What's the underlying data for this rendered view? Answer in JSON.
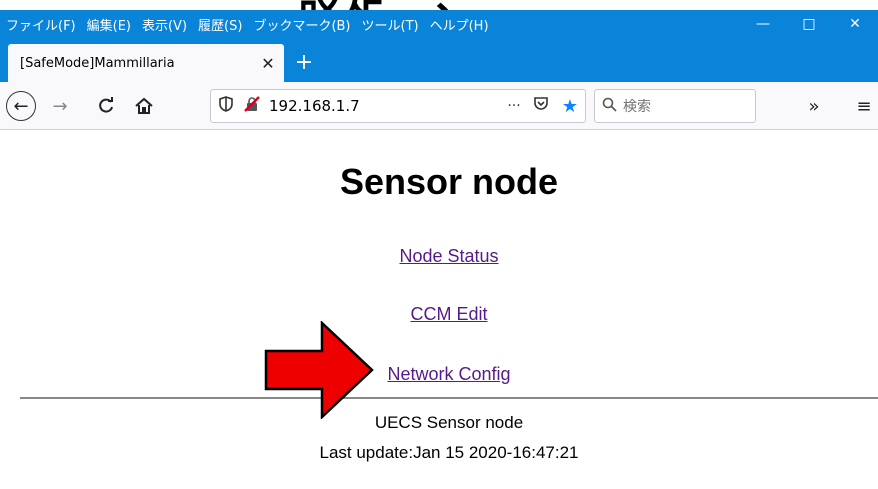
{
  "banner": {
    "text": "ー設定ー、"
  },
  "menubar": {
    "items": [
      "ファイル(F)",
      "編集(E)",
      "表示(V)",
      "履歴(S)",
      "ブックマーク(B)",
      "ツール(T)",
      "ヘルプ(H)"
    ],
    "minimize": "—",
    "maximize": "□",
    "close": "✕"
  },
  "tab": {
    "title": "[SafeMode]Mammillaria",
    "close": "✕",
    "new_tab": "+"
  },
  "navbar": {
    "back": "←",
    "forward": "→",
    "reload": "C",
    "home": "⌂",
    "url": "192.168.1.7",
    "more": "···",
    "search_placeholder": "検索",
    "overflow": "»",
    "menu": "≡"
  },
  "page": {
    "title": "Sensor node",
    "links": [
      "Node Status",
      "CCM Edit",
      "Network Config"
    ],
    "footer_name": "UECS Sensor node",
    "footer_update": "Last update:Jan 15 2020-16:47:21"
  },
  "colors": {
    "chrome_blue": "#0a84d8",
    "link_visited": "#551a8b",
    "arrow_fill": "#ee0000",
    "star_blue": "#0a84ff"
  },
  "icons": {
    "tracking": "shield-icon",
    "insecure": "crossed-lock-icon",
    "pocket": "pocket-icon",
    "bookmark": "star-icon",
    "search": "magnifier-icon",
    "annotation": "red-arrow-icon"
  }
}
